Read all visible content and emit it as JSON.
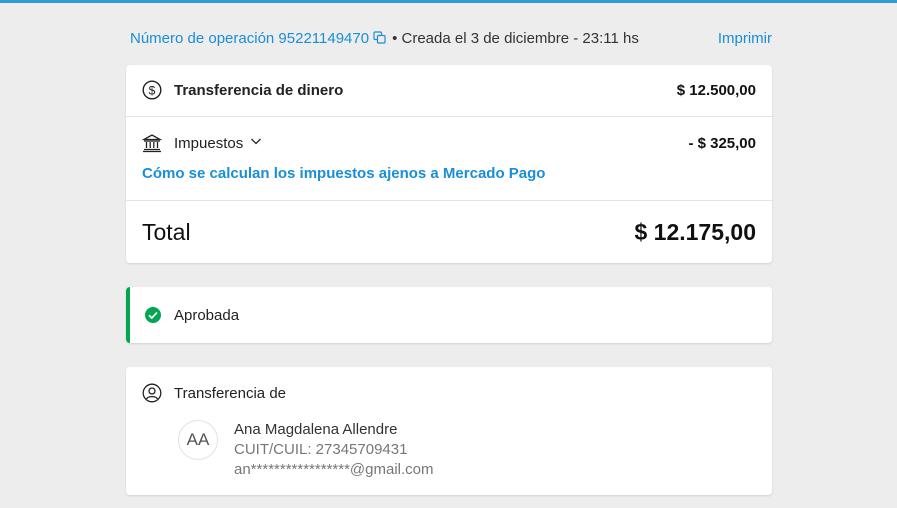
{
  "header": {
    "operation_label": "Número de operación 95221149470",
    "created": "• Creada el 3 de diciembre - 23:11 hs",
    "print": "Imprimir"
  },
  "summary": {
    "transfer_label": "Transferencia de dinero",
    "transfer_amount": "$ 12.500,00",
    "taxes_label": "Impuestos",
    "taxes_amount": "- $ 325,00",
    "taxes_link": "Cómo se calculan los impuestos ajenos a Mercado Pago",
    "total_label": "Total",
    "total_amount": "$ 12.175,00"
  },
  "status": {
    "label": "Aprobada",
    "color": "#00a650"
  },
  "from": {
    "title": "Transferencia de",
    "initials": "AA",
    "name": "Ana Magdalena Allendre",
    "cuit": "CUIT/CUIL: 27345709431",
    "email": "an*****************@gmail.com"
  },
  "colors": {
    "link": "#1a8ed6",
    "accent_bar": "#2d9bd6",
    "approved": "#00a650"
  },
  "icons": [
    "copy-icon",
    "dollar-circle-icon",
    "bank-icon",
    "chevron-down-icon",
    "check-circle-icon",
    "user-circle-icon"
  ]
}
